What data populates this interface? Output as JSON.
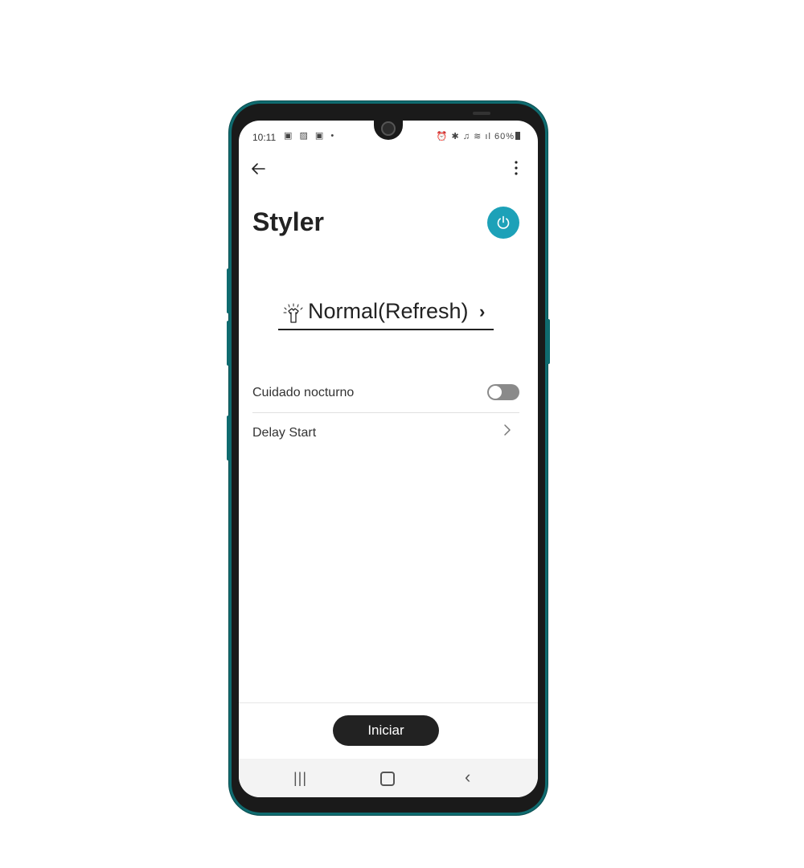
{
  "status_bar": {
    "time": "10:11",
    "left_icons": "▣ ▨ ▣ •",
    "right_icons": "⏰ ✱ ♫ ≋ ıl",
    "battery": "60%"
  },
  "app_bar": {
    "back_icon": "arrow-left-icon",
    "more_icon": "more-vert-icon"
  },
  "header": {
    "title": "Styler",
    "power_color": "#1da1b8"
  },
  "course": {
    "label": "Normal(Refresh)",
    "icon": "shirt-refresh-icon"
  },
  "settings": [
    {
      "label": "Cuidado nocturno",
      "control": "toggle",
      "on": false
    },
    {
      "label": "Delay Start",
      "control": "chevron"
    }
  ],
  "actions": {
    "start_label": "Iniciar"
  },
  "nav": {
    "recent": "|||",
    "back": "‹"
  },
  "colors": {
    "accent": "#1da1b8",
    "frame": "#0f6b6f"
  }
}
